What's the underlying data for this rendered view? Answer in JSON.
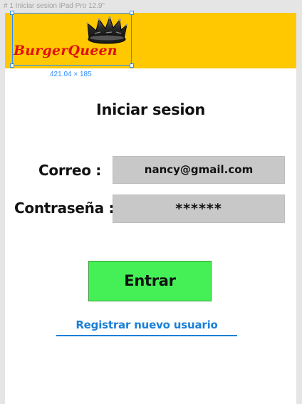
{
  "editor": {
    "frame_label": "# 1 Iniciar sesion iPad Pro 12.9\"",
    "selection_size": "421.04 × 185",
    "selection_color": "#2f8cff"
  },
  "header": {
    "brand": "BurgerQueen",
    "crown_icon": "crown-icon",
    "background_color": "#ffc800",
    "brand_color": "#e01010"
  },
  "login": {
    "title": "Iniciar sesion",
    "email_label": "Correo :",
    "email_value": "nancy@gmail.com",
    "password_label": "Contraseña :",
    "password_value": "******",
    "submit_label": "Entrar",
    "submit_color": "#44f055",
    "register_label": "Registrar nuevo usuario",
    "link_color": "#1a7fd8",
    "field_color": "#c8c8c8"
  }
}
